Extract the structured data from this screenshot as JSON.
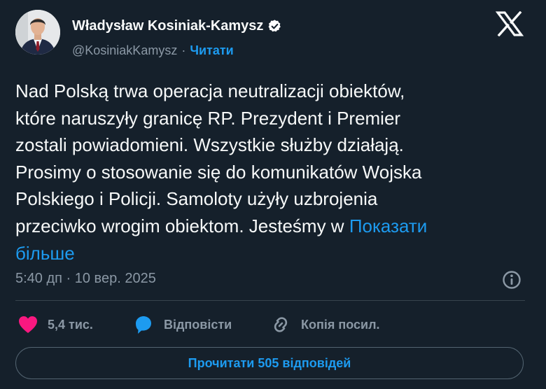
{
  "author": {
    "display_name": "Władysław Kosiniak-Kamysz",
    "handle": "@KosiniakKamysz",
    "separator": "·",
    "follow_label": "Читати"
  },
  "tweet": {
    "text": "Nad Polską trwa operacja neutralizacji obiektów,\nktóre naruszyły granicę RP. Prezydent i Premier\nzostali powiadomieni. Wszystkie służby działają.\nProsimy o stosowanie się do komunikatów Wojska\nPolskiego i Policji. Samoloty użyły uzbrojenia\nprzeciwko wrogim obiektom. Jesteśmy w ",
    "show_more_label": "Показати\nбільше",
    "timestamp": "5:40 дп · 10 вер. 2025"
  },
  "actions": {
    "like_count": "5,4 тис.",
    "reply_label": "Відповісти",
    "copy_link_label": "Копія посил."
  },
  "read_replies_label": "Прочитати 505 відповідей",
  "colors": {
    "background": "#15202b",
    "text": "#f7f9f9",
    "muted": "#8b98a5",
    "accent": "#1d9bf0",
    "like": "#f91880",
    "divider": "#38444d"
  },
  "icons": [
    "verified-badge-icon",
    "x-logo-icon",
    "info-icon",
    "heart-icon",
    "reply-bubble-icon",
    "link-icon"
  ]
}
